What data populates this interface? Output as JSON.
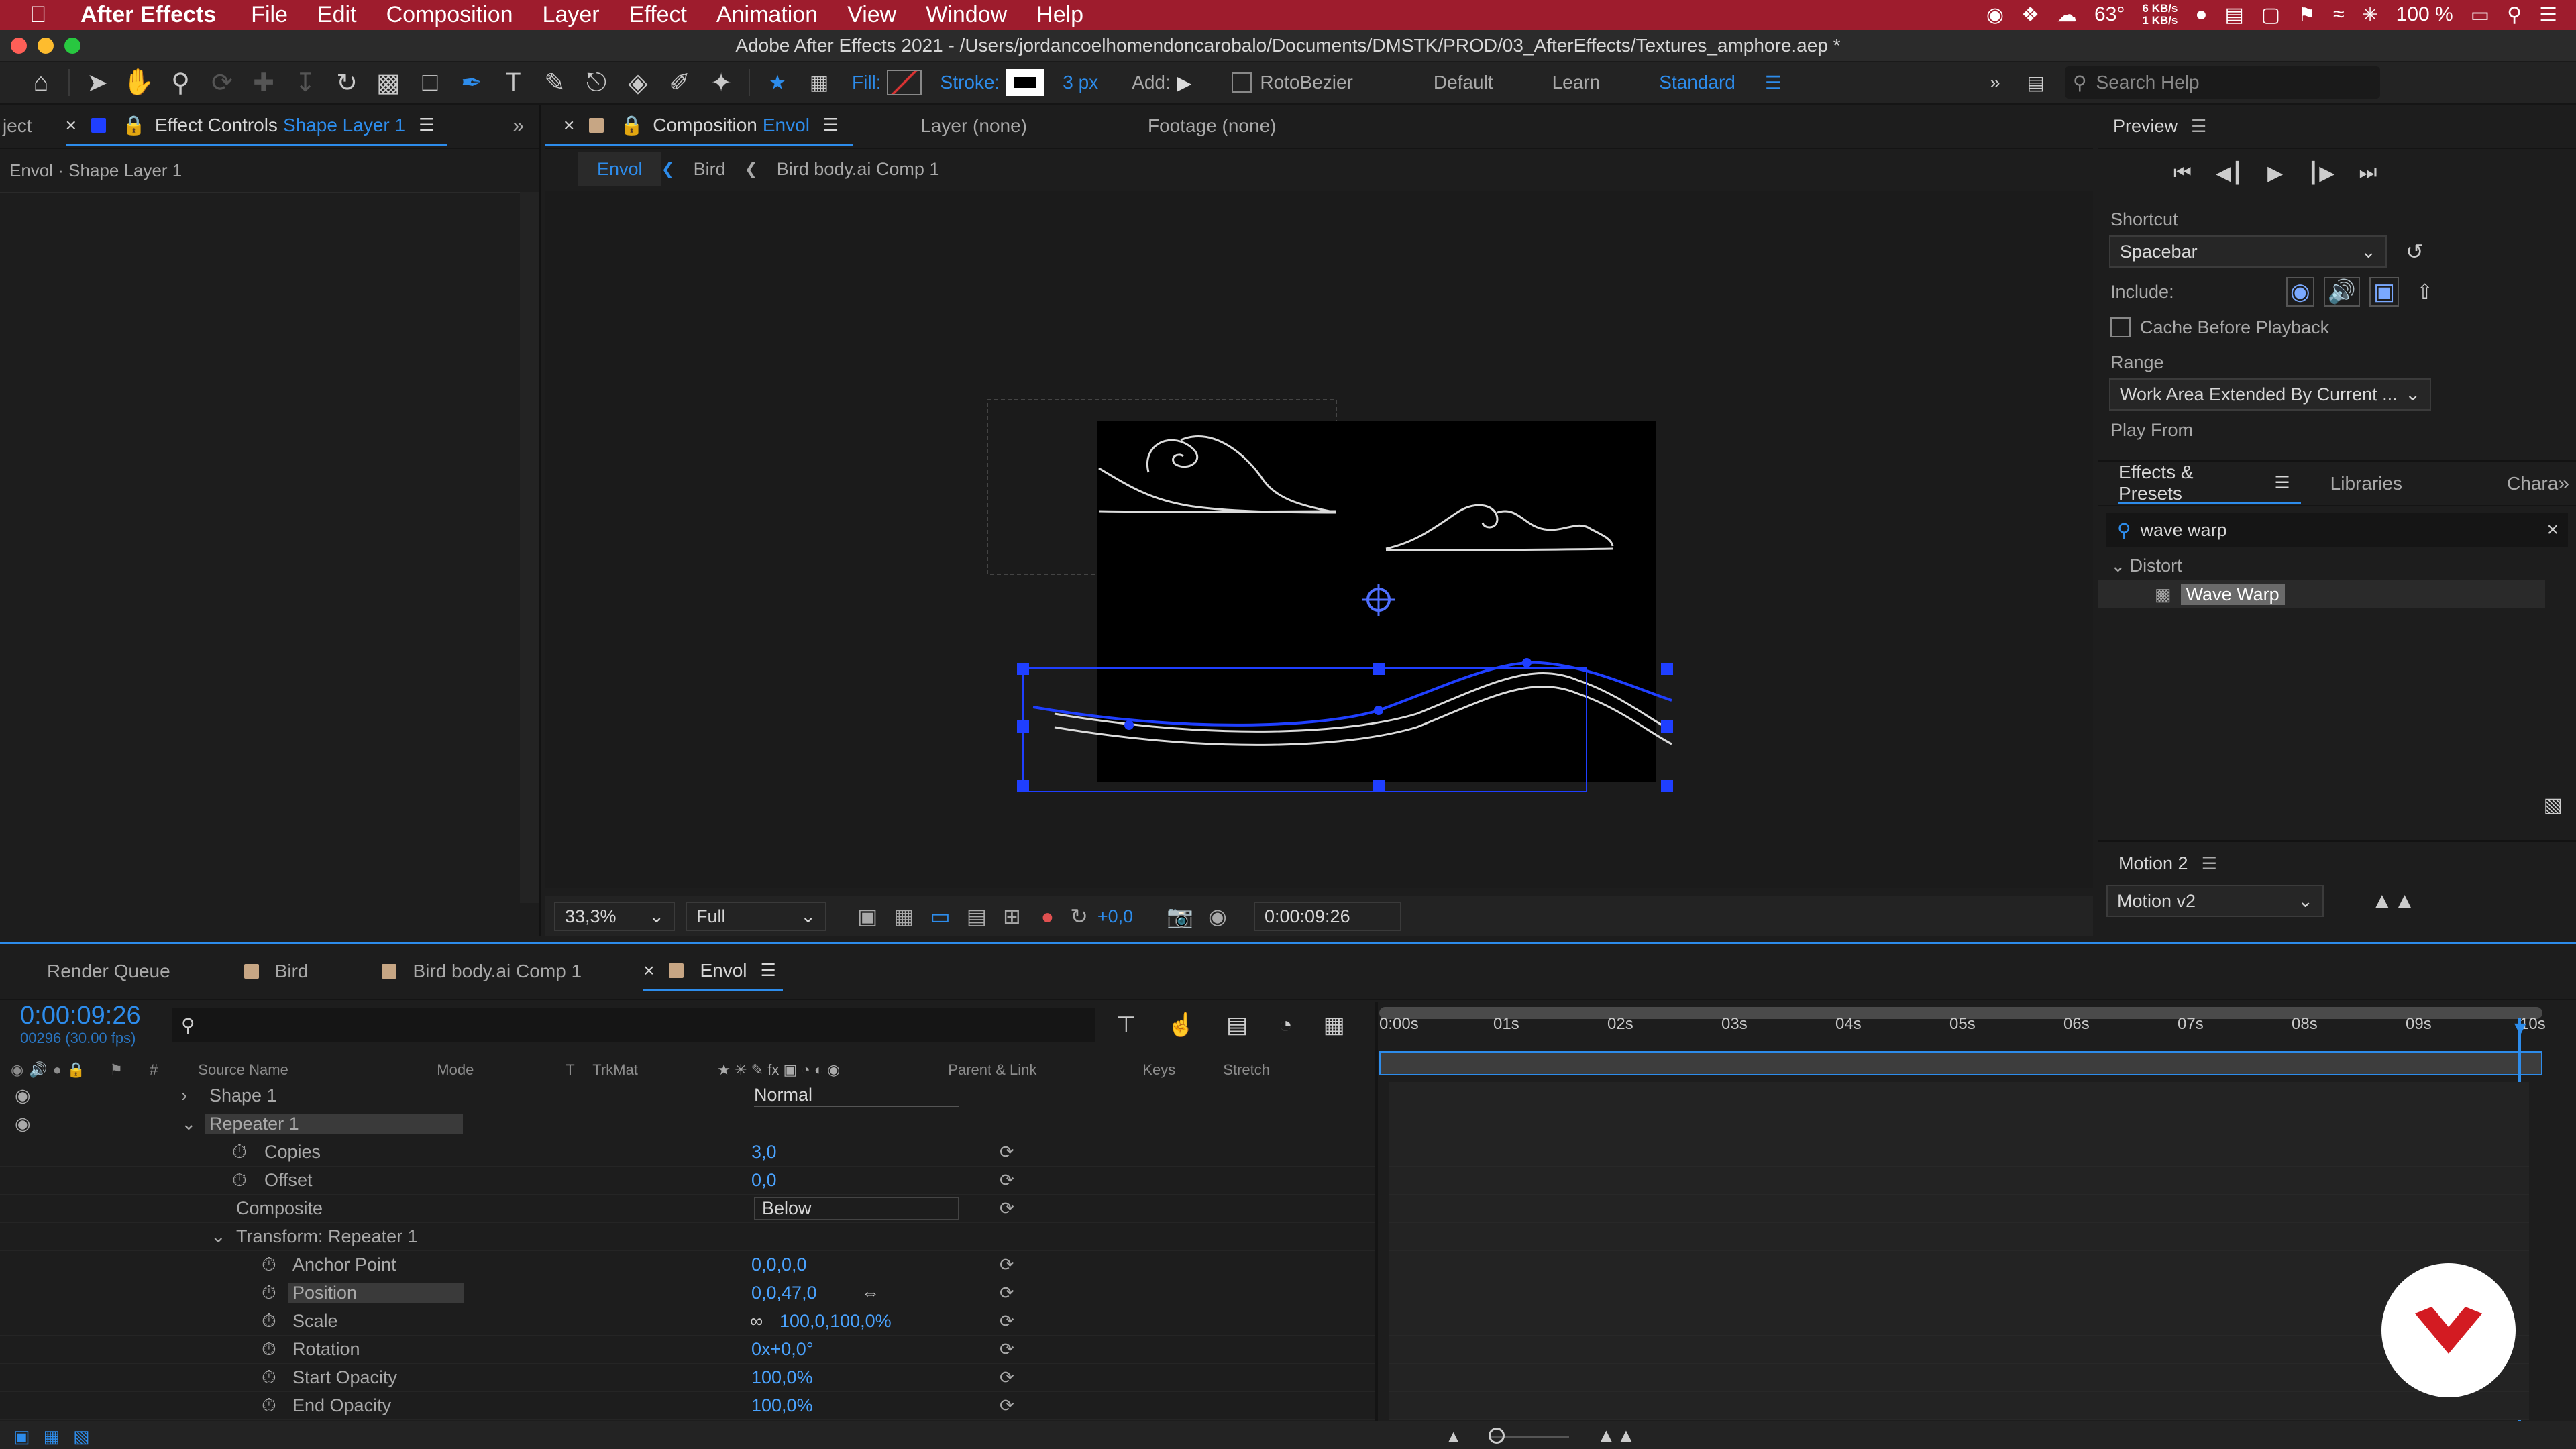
{
  "menubar": {
    "app": "After Effects",
    "menus": [
      "File",
      "Edit",
      "Composition",
      "Layer",
      "Effect",
      "Animation",
      "View",
      "Window",
      "Help"
    ],
    "temp": "63°",
    "net_up": "6 KB/s",
    "net_down": "1 KB/s",
    "battery": "100 %"
  },
  "window": {
    "title": "Adobe After Effects 2021 - /Users/jordancoelhomendoncarobalo/Documents/DMSTK/PROD/03_AfterEffects/Textures_amphore.aep *"
  },
  "toolbar": {
    "fill_label": "Fill:",
    "stroke_label": "Stroke:",
    "stroke_width": "3 px",
    "add_label": "Add:",
    "rotobezier": "RotoBezier",
    "workspaces": [
      "Default",
      "Learn",
      "Standard"
    ],
    "search_placeholder": "Search Help"
  },
  "effect_controls": {
    "tab_prev": "ject",
    "tab_label": "Effect Controls",
    "tab_layer": "Shape Layer 1",
    "subtitle": "Envol · Shape Layer 1"
  },
  "composition": {
    "tab_label": "Composition",
    "tab_name": "Envol",
    "layer_tab": "Layer (none)",
    "footage_tab": "Footage (none)",
    "breadcrumbs": [
      "Envol",
      "Bird",
      "Bird body.ai Comp 1"
    ],
    "zoom": "33,3%",
    "resolution": "Full",
    "exposure": "+0,0",
    "timecode": "0:00:09:26"
  },
  "preview": {
    "title": "Preview",
    "shortcut_label": "Shortcut",
    "shortcut_value": "Spacebar",
    "include_label": "Include:",
    "cache_label": "Cache Before Playback",
    "range_label": "Range",
    "range_value": "Work Area Extended By Current ...",
    "play_from_label": "Play From"
  },
  "effects_presets": {
    "tabs": [
      "Effects & Presets",
      "Libraries",
      "Chara"
    ],
    "search_value": "wave warp",
    "category": "Distort",
    "item": "Wave Warp"
  },
  "motion": {
    "title": "Motion 2",
    "value": "Motion v2"
  },
  "timeline": {
    "tabs": [
      "Render Queue",
      "Bird",
      "Bird body.ai Comp 1",
      "Envol"
    ],
    "timecode": "0:00:09:26",
    "frame_info": "00296 (30.00 fps)",
    "columns": [
      "Source Name",
      "Mode",
      "T",
      "TrkMat",
      "Parent & Link",
      "Keys",
      "Stretch"
    ],
    "ruler": [
      "0:00s",
      "01s",
      "02s",
      "03s",
      "04s",
      "05s",
      "06s",
      "07s",
      "08s",
      "09s",
      "10s"
    ],
    "rows": [
      {
        "name": "Shape 1",
        "value": "Normal"
      },
      {
        "name": "Repeater 1",
        "value": ""
      },
      {
        "name": "Copies",
        "value": "3,0"
      },
      {
        "name": "Offset",
        "value": "0,0"
      },
      {
        "name": "Composite",
        "value": "Below"
      },
      {
        "name": "Transform: Repeater 1",
        "value": ""
      },
      {
        "name": "Anchor Point",
        "value": "0,0,0,0"
      },
      {
        "name": "Position",
        "value": "0,0,47,0"
      },
      {
        "name": "Scale",
        "value": "100,0,100,0%"
      },
      {
        "name": "Rotation",
        "value": "0x+0,0°"
      },
      {
        "name": "Start Opacity",
        "value": "100,0%"
      },
      {
        "name": "End Opacity",
        "value": "100,0%"
      }
    ]
  },
  "colors": {
    "accent": "#2d8ceb",
    "menubar": "#9e1c2d",
    "selection": "#1f3fff"
  }
}
